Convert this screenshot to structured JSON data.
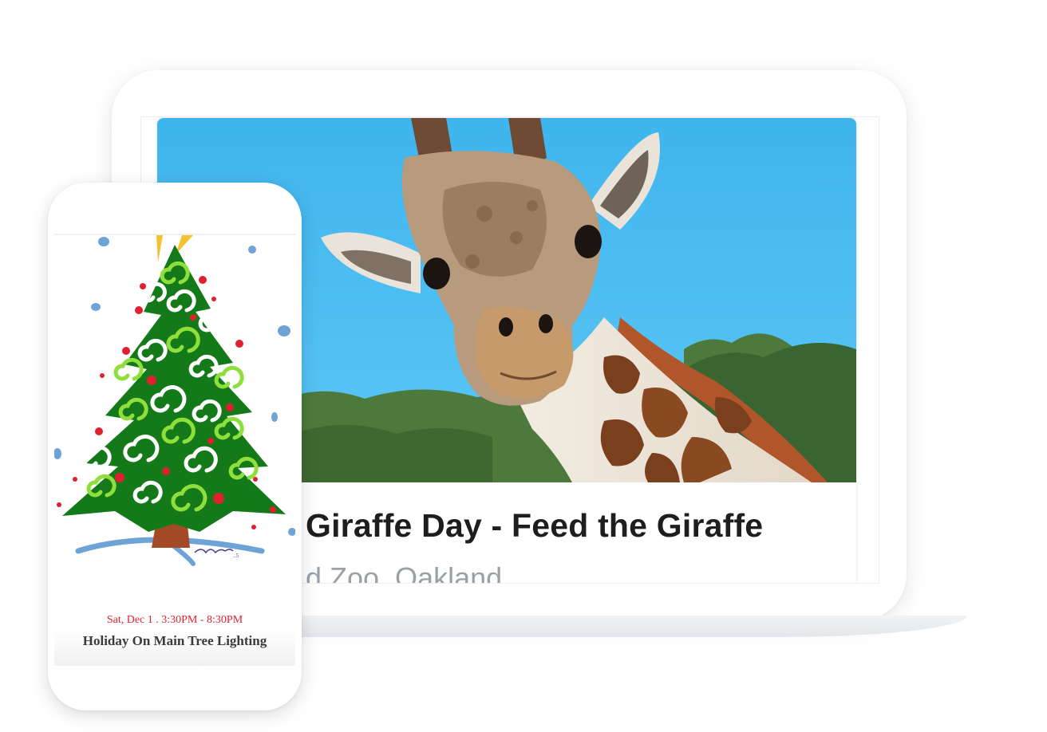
{
  "laptop": {
    "event": {
      "image_name": "giraffe-photo",
      "title": "Giraffe Day - Feed the Giraffe",
      "location": "d Zoo, Oakland"
    }
  },
  "phone": {
    "event": {
      "image_name": "christmas-tree-illustration",
      "date": "Sat, Dec 1 . 3:30PM - 8:30PM",
      "title": "Holiday On Main Tree Lighting"
    }
  },
  "colors": {
    "date_red": "#e2232e",
    "title_dark": "#1e1e1e",
    "location_gray": "#9aa0a6",
    "sky_blue": "#4cbcf0",
    "tree_green": "#17781a"
  }
}
